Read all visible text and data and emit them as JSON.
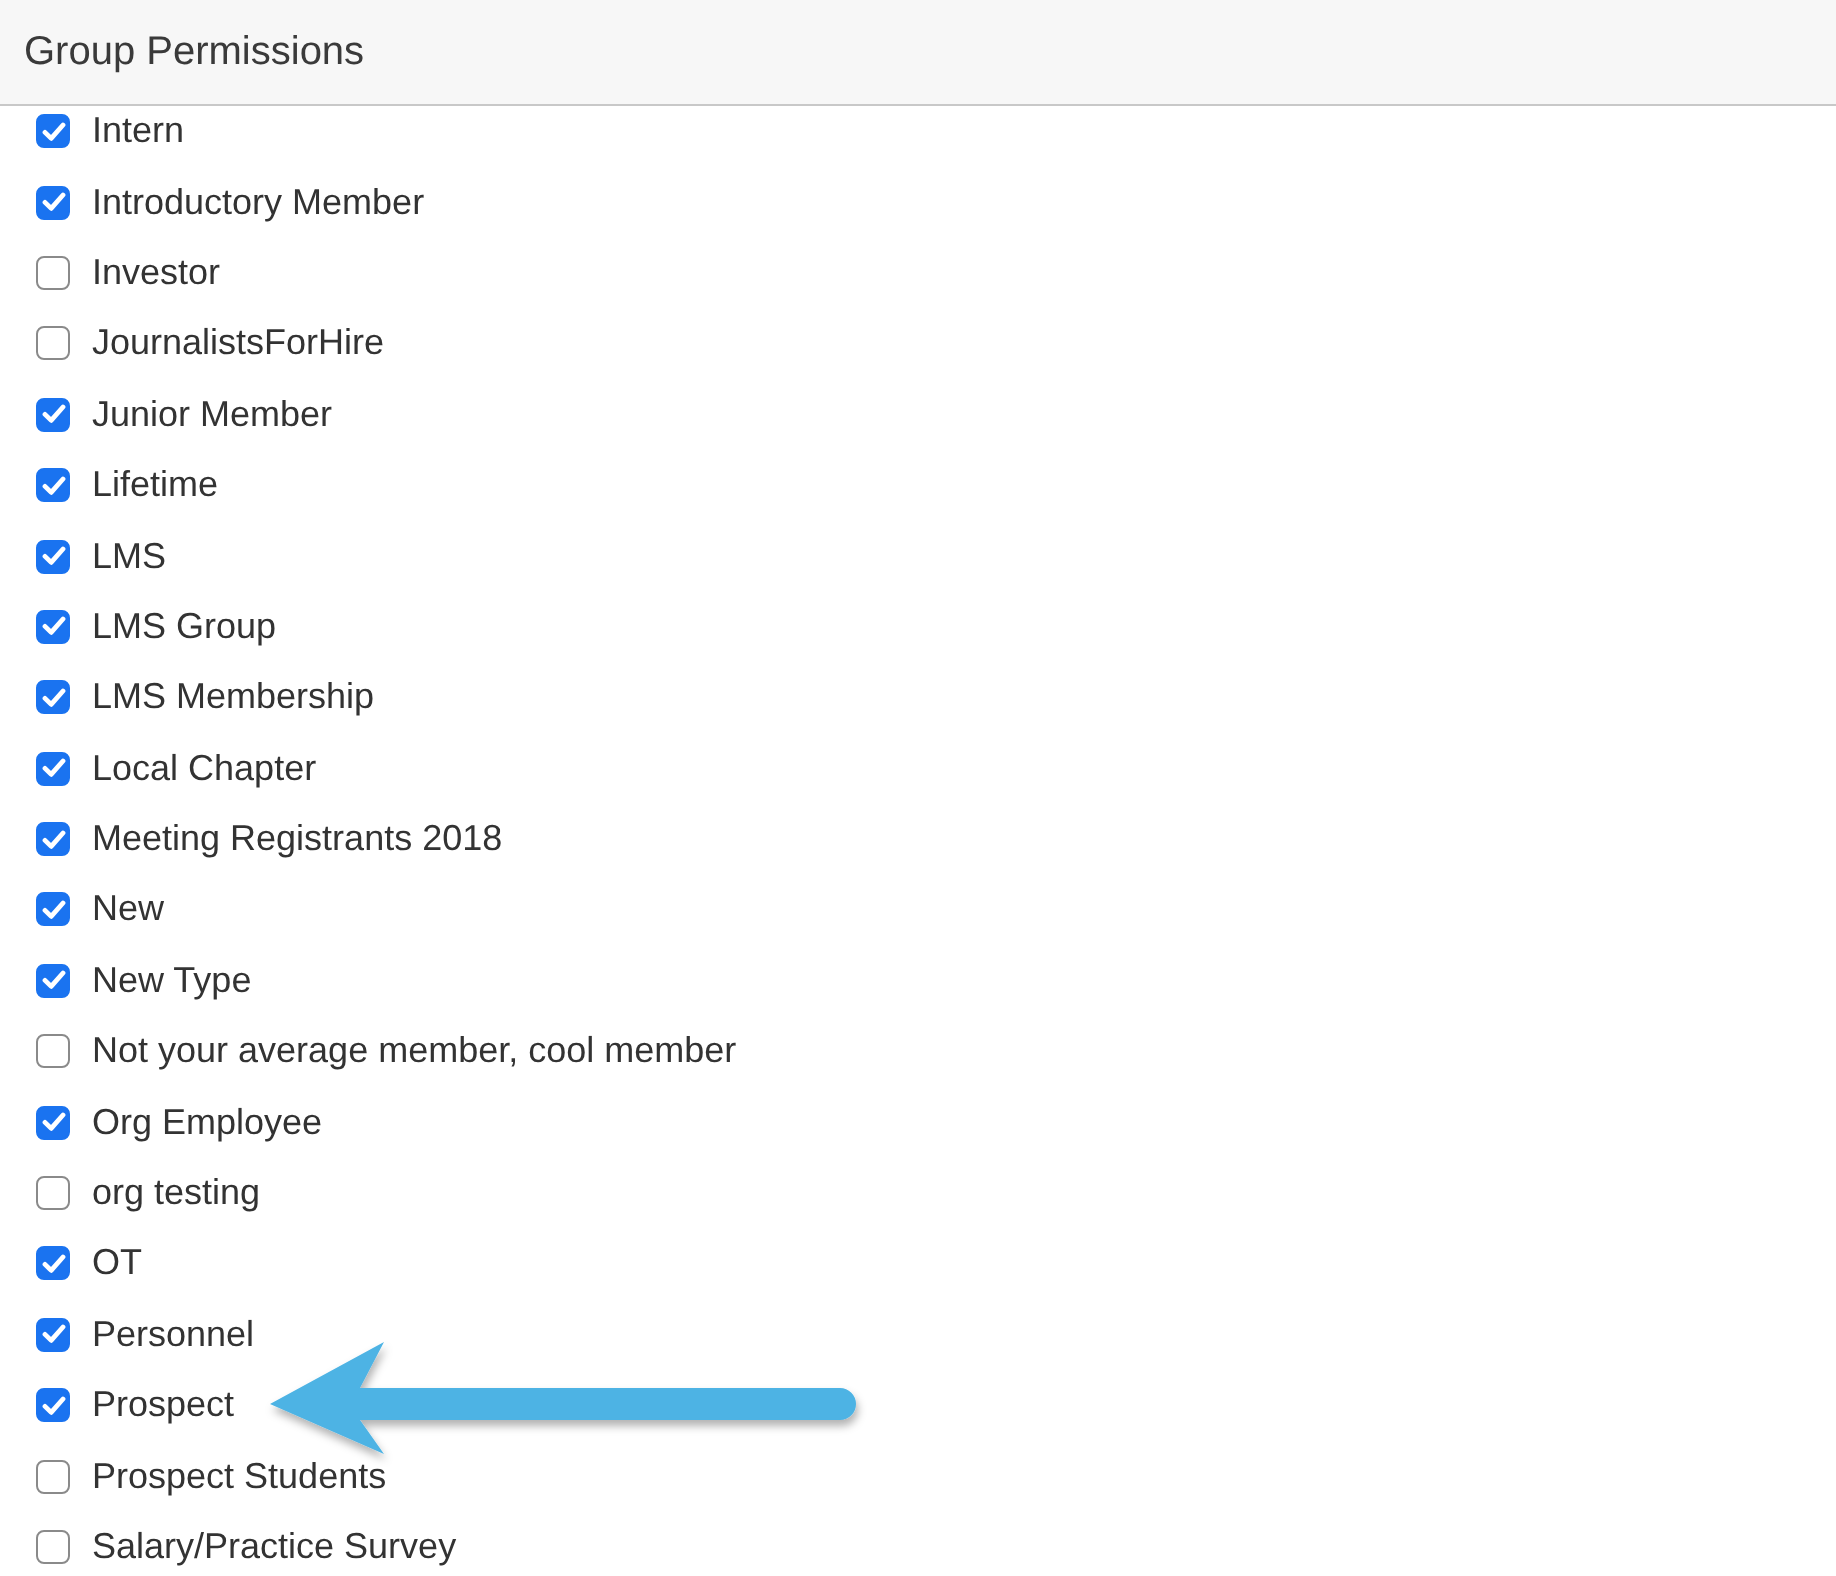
{
  "panel": {
    "title": "Group Permissions"
  },
  "groups": [
    {
      "label": "Intern",
      "checked": true
    },
    {
      "label": "Introductory Member",
      "checked": true
    },
    {
      "label": "Investor",
      "checked": false
    },
    {
      "label": "JournalistsForHire",
      "checked": false
    },
    {
      "label": "Junior Member",
      "checked": true
    },
    {
      "label": "Lifetime",
      "checked": true
    },
    {
      "label": "LMS",
      "checked": true
    },
    {
      "label": "LMS Group",
      "checked": true
    },
    {
      "label": "LMS Membership",
      "checked": true
    },
    {
      "label": "Local Chapter",
      "checked": true
    },
    {
      "label": "Meeting Registrants 2018",
      "checked": true
    },
    {
      "label": "New",
      "checked": true
    },
    {
      "label": "New Type",
      "checked": true
    },
    {
      "label": "Not your average member, cool member",
      "checked": false
    },
    {
      "label": "Org Employee",
      "checked": true
    },
    {
      "label": "org testing",
      "checked": false
    },
    {
      "label": "OT",
      "checked": true
    },
    {
      "label": "Personnel",
      "checked": true
    },
    {
      "label": "Prospect",
      "checked": true
    },
    {
      "label": "Prospect Students",
      "checked": false
    },
    {
      "label": "Salary/Practice Survey",
      "checked": false
    }
  ]
}
